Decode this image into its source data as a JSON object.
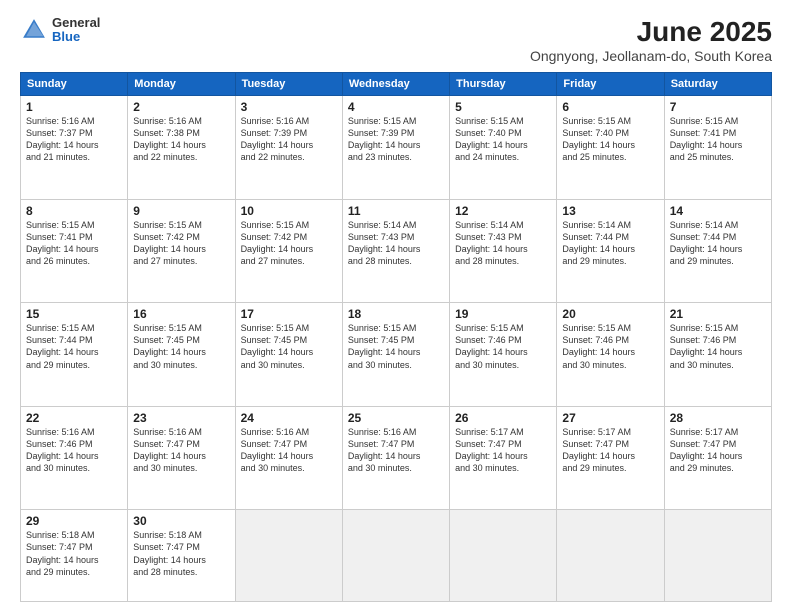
{
  "header": {
    "logo_general": "General",
    "logo_blue": "Blue",
    "title": "June 2025",
    "subtitle": "Ongnyong, Jeollanam-do, South Korea"
  },
  "calendar": {
    "days_of_week": [
      "Sunday",
      "Monday",
      "Tuesday",
      "Wednesday",
      "Thursday",
      "Friday",
      "Saturday"
    ],
    "weeks": [
      [
        {
          "day": "",
          "info": ""
        },
        {
          "day": "2",
          "info": "Sunrise: 5:16 AM\nSunset: 7:38 PM\nDaylight: 14 hours\nand 22 minutes."
        },
        {
          "day": "3",
          "info": "Sunrise: 5:16 AM\nSunset: 7:39 PM\nDaylight: 14 hours\nand 22 minutes."
        },
        {
          "day": "4",
          "info": "Sunrise: 5:15 AM\nSunset: 7:39 PM\nDaylight: 14 hours\nand 23 minutes."
        },
        {
          "day": "5",
          "info": "Sunrise: 5:15 AM\nSunset: 7:40 PM\nDaylight: 14 hours\nand 24 minutes."
        },
        {
          "day": "6",
          "info": "Sunrise: 5:15 AM\nSunset: 7:40 PM\nDaylight: 14 hours\nand 25 minutes."
        },
        {
          "day": "7",
          "info": "Sunrise: 5:15 AM\nSunset: 7:41 PM\nDaylight: 14 hours\nand 25 minutes."
        }
      ],
      [
        {
          "day": "8",
          "info": "Sunrise: 5:15 AM\nSunset: 7:41 PM\nDaylight: 14 hours\nand 26 minutes."
        },
        {
          "day": "9",
          "info": "Sunrise: 5:15 AM\nSunset: 7:42 PM\nDaylight: 14 hours\nand 27 minutes."
        },
        {
          "day": "10",
          "info": "Sunrise: 5:15 AM\nSunset: 7:42 PM\nDaylight: 14 hours\nand 27 minutes."
        },
        {
          "day": "11",
          "info": "Sunrise: 5:14 AM\nSunset: 7:43 PM\nDaylight: 14 hours\nand 28 minutes."
        },
        {
          "day": "12",
          "info": "Sunrise: 5:14 AM\nSunset: 7:43 PM\nDaylight: 14 hours\nand 28 minutes."
        },
        {
          "day": "13",
          "info": "Sunrise: 5:14 AM\nSunset: 7:44 PM\nDaylight: 14 hours\nand 29 minutes."
        },
        {
          "day": "14",
          "info": "Sunrise: 5:14 AM\nSunset: 7:44 PM\nDaylight: 14 hours\nand 29 minutes."
        }
      ],
      [
        {
          "day": "15",
          "info": "Sunrise: 5:15 AM\nSunset: 7:44 PM\nDaylight: 14 hours\nand 29 minutes."
        },
        {
          "day": "16",
          "info": "Sunrise: 5:15 AM\nSunset: 7:45 PM\nDaylight: 14 hours\nand 30 minutes."
        },
        {
          "day": "17",
          "info": "Sunrise: 5:15 AM\nSunset: 7:45 PM\nDaylight: 14 hours\nand 30 minutes."
        },
        {
          "day": "18",
          "info": "Sunrise: 5:15 AM\nSunset: 7:45 PM\nDaylight: 14 hours\nand 30 minutes."
        },
        {
          "day": "19",
          "info": "Sunrise: 5:15 AM\nSunset: 7:46 PM\nDaylight: 14 hours\nand 30 minutes."
        },
        {
          "day": "20",
          "info": "Sunrise: 5:15 AM\nSunset: 7:46 PM\nDaylight: 14 hours\nand 30 minutes."
        },
        {
          "day": "21",
          "info": "Sunrise: 5:15 AM\nSunset: 7:46 PM\nDaylight: 14 hours\nand 30 minutes."
        }
      ],
      [
        {
          "day": "22",
          "info": "Sunrise: 5:16 AM\nSunset: 7:46 PM\nDaylight: 14 hours\nand 30 minutes."
        },
        {
          "day": "23",
          "info": "Sunrise: 5:16 AM\nSunset: 7:47 PM\nDaylight: 14 hours\nand 30 minutes."
        },
        {
          "day": "24",
          "info": "Sunrise: 5:16 AM\nSunset: 7:47 PM\nDaylight: 14 hours\nand 30 minutes."
        },
        {
          "day": "25",
          "info": "Sunrise: 5:16 AM\nSunset: 7:47 PM\nDaylight: 14 hours\nand 30 minutes."
        },
        {
          "day": "26",
          "info": "Sunrise: 5:17 AM\nSunset: 7:47 PM\nDaylight: 14 hours\nand 30 minutes."
        },
        {
          "day": "27",
          "info": "Sunrise: 5:17 AM\nSunset: 7:47 PM\nDaylight: 14 hours\nand 29 minutes."
        },
        {
          "day": "28",
          "info": "Sunrise: 5:17 AM\nSunset: 7:47 PM\nDaylight: 14 hours\nand 29 minutes."
        }
      ],
      [
        {
          "day": "29",
          "info": "Sunrise: 5:18 AM\nSunset: 7:47 PM\nDaylight: 14 hours\nand 29 minutes."
        },
        {
          "day": "30",
          "info": "Sunrise: 5:18 AM\nSunset: 7:47 PM\nDaylight: 14 hours\nand 28 minutes."
        },
        {
          "day": "",
          "info": ""
        },
        {
          "day": "",
          "info": ""
        },
        {
          "day": "",
          "info": ""
        },
        {
          "day": "",
          "info": ""
        },
        {
          "day": "",
          "info": ""
        }
      ]
    ],
    "week1_day1": {
      "day": "1",
      "info": "Sunrise: 5:16 AM\nSunset: 7:37 PM\nDaylight: 14 hours\nand 21 minutes."
    }
  }
}
